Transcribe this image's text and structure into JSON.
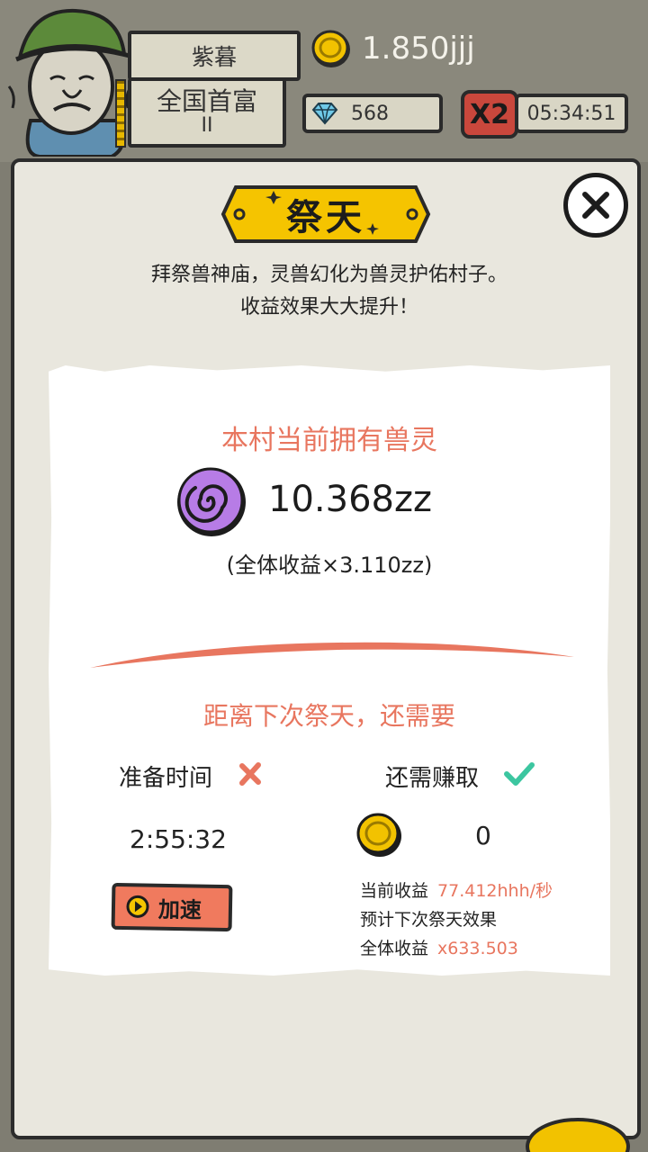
{
  "header": {
    "player_name": "紫暮",
    "rank_title": "全国首富",
    "rank_tier": "II",
    "coins": "1.850jjj",
    "gems": "568",
    "boost_badge": "X2",
    "boost_timer": "05:34:51"
  },
  "dialog": {
    "title": "祭天",
    "description_line1": "拜祭兽神庙，灵兽幻化为兽灵护佑村子。",
    "description_line2": "收益效果大大提升！",
    "panel": {
      "heading": "本村当前拥有兽灵",
      "spirit_count": "10.368zz",
      "spirit_bonus": "(全体收益×3.110zz)",
      "next_heading": "距离下次祭天，还需要",
      "prep_label": "准备时间",
      "prep_time": "2:55:32",
      "earn_label": "还需赚取",
      "earn_value": "0",
      "speed_button": "加速",
      "current_income_label": "当前收益",
      "current_income_value": "77.412hhh/秒",
      "forecast_label": "预计下次祭天效果",
      "total_income_label": "全体收益",
      "total_income_value": "x633.503"
    }
  },
  "colors": {
    "accent_orange": "#e8765f",
    "check_green": "#3cc6a0",
    "coin_gold": "#f2c200",
    "spirit_purple": "#b77ce6",
    "banner_yellow": "#f5c400"
  }
}
